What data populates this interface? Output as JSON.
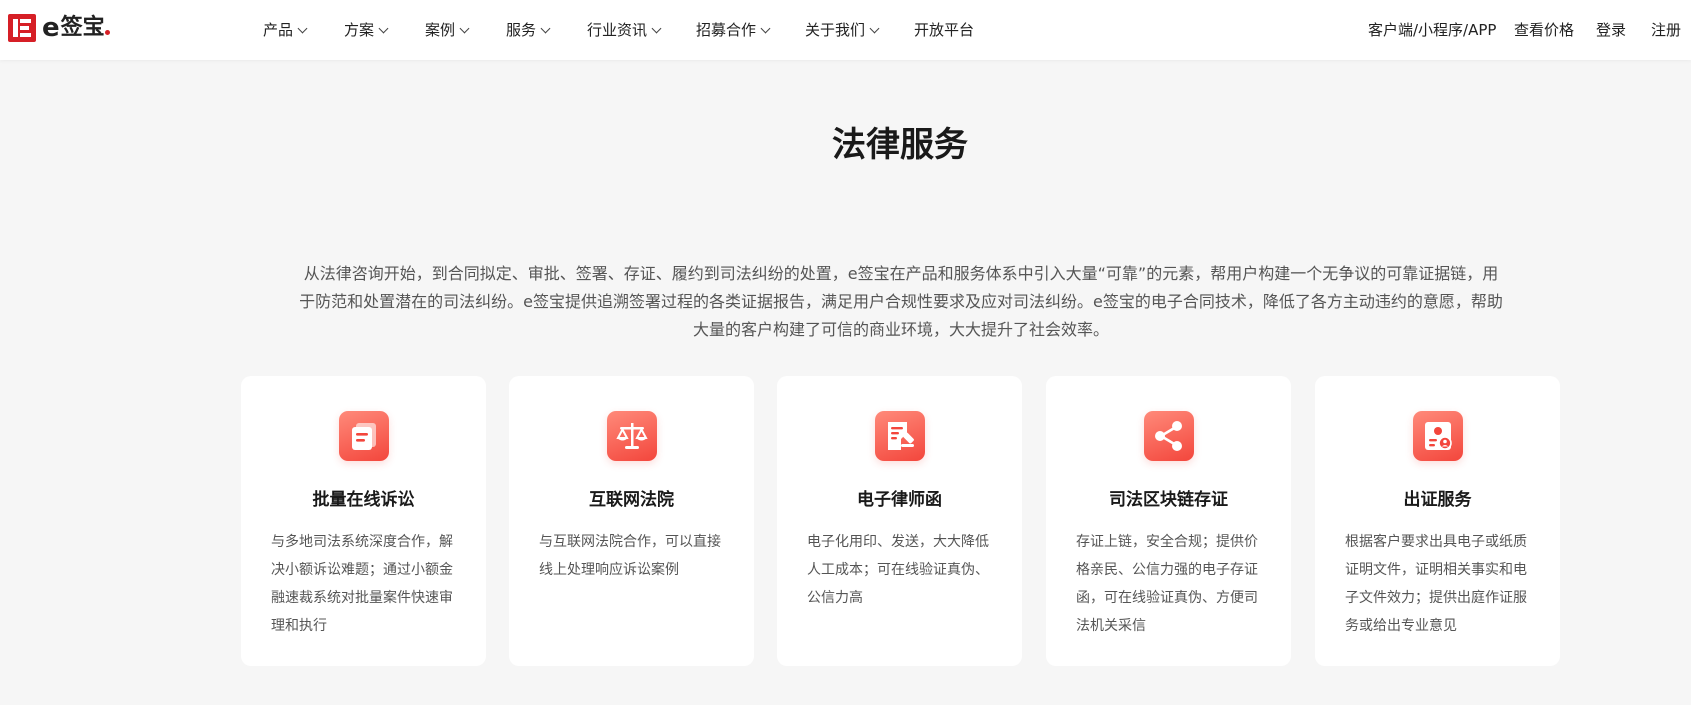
{
  "header": {
    "logo": {
      "e": "e",
      "name": "签宝"
    },
    "nav": [
      {
        "label": "产品",
        "dropdown": true
      },
      {
        "label": "方案",
        "dropdown": true
      },
      {
        "label": "案例",
        "dropdown": true
      },
      {
        "label": "服务",
        "dropdown": true
      },
      {
        "label": "行业资讯",
        "dropdown": true
      },
      {
        "label": "招募合作",
        "dropdown": true
      },
      {
        "label": "关于我们",
        "dropdown": true
      },
      {
        "label": "开放平台",
        "dropdown": false
      }
    ],
    "right": {
      "client": "客户端/小程序/APP",
      "pricing": "查看价格",
      "login": "登录",
      "register": "注册"
    }
  },
  "section": {
    "title": "法律服务",
    "intro": "从法律咨询开始，到合同拟定、审批、签署、存证、履约到司法纠纷的处置，e签宝在产品和服务体系中引入大量“可靠”的元素，帮用户构建一个无争议的可靠证据链，用于防范和处置潜在的司法纠纷。e签宝提供追溯签署过程的各类证据报告，满足用户合规性要求及应对司法纠纷。e签宝的电子合同技术，降低了各方主动违约的意愿，帮助大量的客户构建了可信的商业环境，大大提升了社会效率。"
  },
  "cards": [
    {
      "icon": "document-stack-icon",
      "title": "批量在线诉讼",
      "desc": "与多地司法系统深度合作，解决小额诉讼难题；通过小额金融速裁系统对批量案件快速审理和执行"
    },
    {
      "icon": "scales-icon",
      "title": "互联网法院",
      "desc": "与互联网法院合作，可以直接线上处理响应诉讼案例"
    },
    {
      "icon": "gavel-document-icon",
      "title": "电子律师函",
      "desc": "电子化用印、发送，大大降低人工成本；可在线验证真伪、公信力高"
    },
    {
      "icon": "share-nodes-icon",
      "title": "司法区块链存证",
      "desc": "存证上链，安全合规；提供价格亲民、公信力强的电子存证函，可在线验证真伪、方便司法机关采信"
    },
    {
      "icon": "certificate-icon",
      "title": "出证服务",
      "desc": "根据客户要求出具电子或纸质证明文件，证明相关事实和电子文件效力；提供出庭作证服务或给出专业意见"
    }
  ],
  "colors": {
    "brand_red": "#d61f26",
    "icon_gradient_top": "#ff8a7a",
    "icon_gradient_bottom": "#f3463c",
    "page_bg": "#f6f6f6"
  }
}
